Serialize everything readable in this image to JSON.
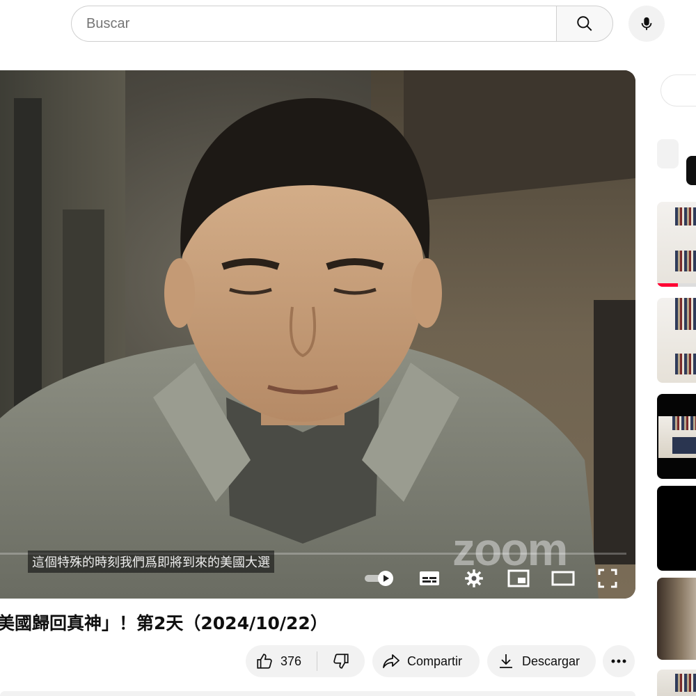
{
  "search": {
    "placeholder": "Buscar"
  },
  "video": {
    "caption": "這個特殊的時刻我們爲即將到來的美國大選",
    "watermark": "zoom"
  },
  "title": "美國歸回真神」！第2天（2024/10/22）",
  "actions": {
    "like_count": "376",
    "share_label": "Compartir",
    "download_label": "Descargar"
  },
  "colors": {
    "progress_red": "#ff0033",
    "pill_bg": "#f2f2f2"
  },
  "icons": [
    "search-icon",
    "mic-icon",
    "autoplay-toggle-icon",
    "subtitles-icon",
    "settings-gear-icon",
    "miniplayer-icon",
    "theater-mode-icon",
    "fullscreen-icon",
    "thumbs-up-icon",
    "thumbs-down-icon",
    "share-arrow-icon",
    "download-icon",
    "more-dots-icon"
  ]
}
